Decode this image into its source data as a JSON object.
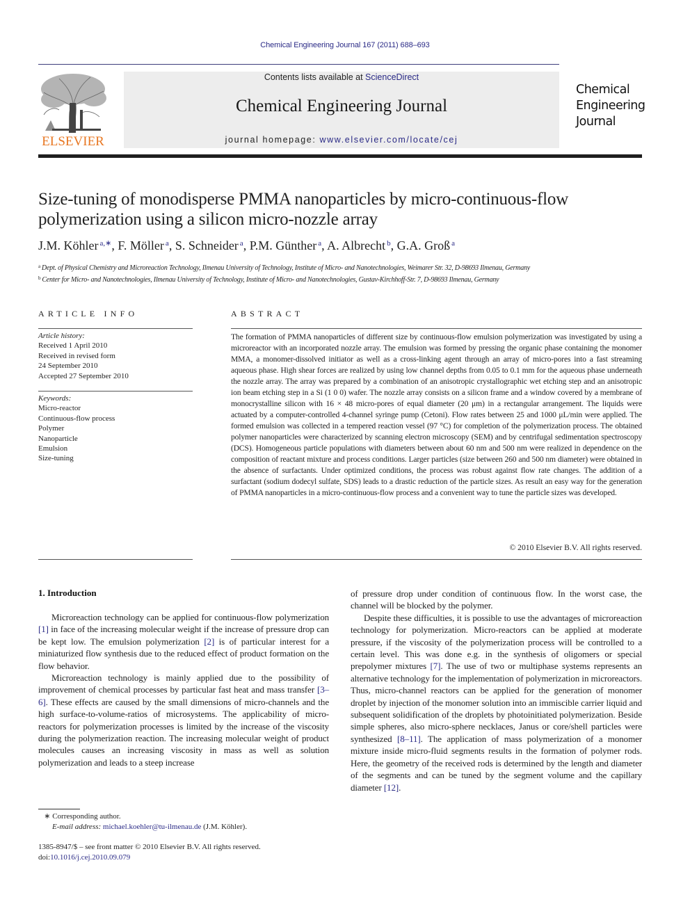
{
  "header": {
    "citation": "Chemical Engineering Journal 167 (2011) 688–693",
    "contents_prefix": "Contents lists available at ",
    "contents_link": "ScienceDirect",
    "journal_title": "Chemical Engineering Journal",
    "homepage_prefix": "journal homepage: ",
    "homepage_link": "www.elsevier.com/locate/cej",
    "publisher_logo_text": "ELSEVIER",
    "publisher_color": "#e87722",
    "link_color": "#2a2a86",
    "cover_title_lines": [
      "Chemical",
      "Engineering",
      "Journal"
    ]
  },
  "article": {
    "title_line1": "Size-tuning of monodisperse PMMA nanoparticles by micro-continuous-flow",
    "title_line2": "polymerization using a silicon micro-nozzle array",
    "authors": [
      {
        "name": "J.M. Köhler",
        "sup": "a,∗",
        "sep": ", "
      },
      {
        "name": "F. Möller",
        "sup": "a",
        "sep": ", "
      },
      {
        "name": "S. Schneider",
        "sup": "a",
        "sep": ", "
      },
      {
        "name": "P.M. Günther",
        "sup": "a",
        "sep": ", "
      },
      {
        "name": "A. Albrecht",
        "sup": "b",
        "sep": ", "
      },
      {
        "name": "G.A. Groß",
        "sup": "a",
        "sep": ""
      }
    ],
    "affiliations": [
      {
        "mark": "a",
        "text": "Dept. of Physical Chemistry and Microreaction Technology, Ilmenau University of Technology, Institute of Micro- and Nanotechnologies, Weimarer Str. 32, D-98693 Ilmenau, Germany"
      },
      {
        "mark": "b",
        "text": "Center for Micro- and Nanotechnologies, Ilmenau University of Technology, Institute of Micro- and Nanotechnologies, Gustav-Kirchhoff-Str. 7, D-98693 Ilmenau, Germany"
      }
    ]
  },
  "article_info": {
    "heading": "ARTICLE INFO",
    "history_label": "Article history:",
    "history": [
      "Received 1 April 2010",
      "Received in revised form",
      "24 September 2010",
      "Accepted 27 September 2010"
    ],
    "keywords_label": "Keywords:",
    "keywords": [
      "Micro-reactor",
      "Continuous-flow process",
      "Polymer",
      "Nanoparticle",
      "Emulsion",
      "Size-tuning"
    ]
  },
  "abstract": {
    "heading": "ABSTRACT",
    "text": "The formation of PMMA nanoparticles of different size by continuous-flow emulsion polymerization was investigated by using a microreactor with an incorporated nozzle array. The emulsion was formed by pressing the organic phase containing the monomer MMA, a monomer-dissolved initiator as well as a cross-linking agent through an array of micro-pores into a fast streaming aqueous phase. High shear forces are realized by using low channel depths from 0.05 to 0.1 mm for the aqueous phase underneath the nozzle array. The array was prepared by a combination of an anisotropic crystallographic wet etching step and an anisotropic ion beam etching step in a Si (1 0 0) wafer. The nozzle array consists on a silicon frame and a window covered by a membrane of monocrystalline silicon with 16 × 48 micro-pores of equal diameter (20 μm) in a rectangular arrangement. The liquids were actuated by a computer-controlled 4-channel syringe pump (Cetoni). Flow rates between 25 and 1000 μL/min were applied. The formed emulsion was collected in a tempered reaction vessel (97 °C) for completion of the polymerization process. The obtained polymer nanoparticles were characterized by scanning electron microscopy (SEM) and by centrifugal sedimentation spectroscopy (DCS). Homogeneous particle populations with diameters between about 60 nm and 500 nm were realized in dependence on the composition of reactant mixture and process conditions. Larger particles (size between 260 and 500 nm diameter) were obtained in the absence of surfactants. Under optimized conditions, the process was robust against flow rate changes. The addition of a surfactant (sodium dodecyl sulfate, SDS) leads to a drastic reduction of the particle sizes. As result an easy way for the generation of PMMA nanoparticles in a micro-continuous-flow process and a convenient way to tune the particle sizes was developed.",
    "copyright": "© 2010 Elsevier B.V. All rights reserved."
  },
  "body": {
    "section_heading": "1.  Introduction",
    "col1": {
      "p1_a": "Microreaction technology can be applied for continuous-flow polymerization ",
      "p1_ref1": "[1]",
      "p1_b": " in face of the increasing molecular weight if the increase of pressure drop can be kept low. The emulsion polymerization ",
      "p1_ref2": "[2]",
      "p1_c": " is of particular interest for a miniaturized flow synthesis due to the reduced effect of product formation on the flow behavior.",
      "p2_a": "Microreaction technology is mainly applied due to the possibility of improvement of chemical processes by particular fast heat and mass transfer ",
      "p2_ref1": "[3–6]",
      "p2_b": ". These effects are caused by the small dimensions of micro-channels and the high surface-to-volume-ratios of microsystems. The applicability of micro-reactors for polymerization processes is limited by the increase of the viscosity during the polymerization reaction. The increasing molecular weight of product molecules causes an increasing viscosity in mass as well as solution polymerization and leads to a steep increase"
    },
    "col2": {
      "p0": "of pressure drop under condition of continuous flow. In the worst case, the channel will be blocked by the polymer.",
      "p1_a": "Despite these difficulties, it is possible to use the advantages of microreaction technology for polymerization. Micro-reactors can be applied at moderate pressure, if the viscosity of the polymerization process will be controlled to a certain level. This was done e.g. in the synthesis of oligomers or special prepolymer mixtures ",
      "p1_ref1": "[7]",
      "p1_b": ". The use of two or multiphase systems represents an alternative technology for the implementation of polymerization in microreactors. Thus, micro-channel reactors can be applied for the generation of monomer droplet by injection of the monomer solution into an immiscible carrier liquid and subsequent solidification of the droplets by photoinitiated polymerization. Beside simple spheres, also micro-sphere necklaces, Janus or core/shell particles were synthesized ",
      "p1_ref2": "[8–11]",
      "p1_c": ". The application of mass polymerization of a monomer mixture inside micro-fluid segments results in the formation of polymer rods. Here, the geometry of the received rods is determined by the length and diameter of the segments and can be tuned by the segment volume and the capillary diameter ",
      "p1_ref3": "[12]",
      "p1_d": "."
    }
  },
  "footnote": {
    "mark": "∗",
    "corresponding": "Corresponding author.",
    "email_label": "E-mail address: ",
    "email": "michael.koehler@tu-ilmenau.de",
    "email_suffix": " (J.M. Köhler).",
    "front_matter": "1385-8947/$ – see front matter © 2010 Elsevier B.V. All rights reserved.",
    "doi_label": "doi:",
    "doi": "10.1016/j.cej.2010.09.079"
  }
}
